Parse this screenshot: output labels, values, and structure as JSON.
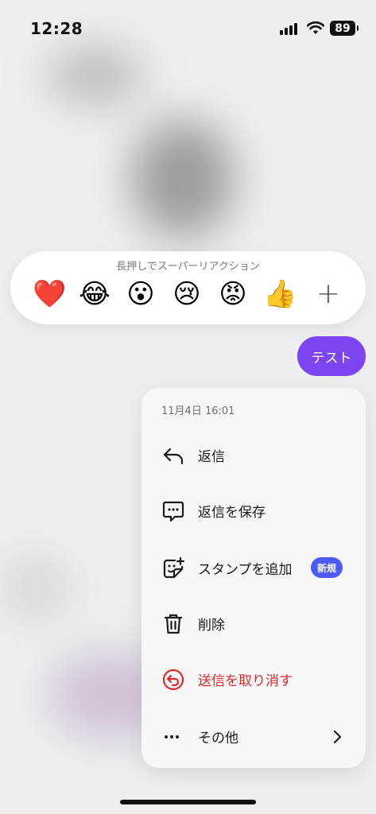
{
  "status_bar": {
    "time": "12:28",
    "battery": "89"
  },
  "reactions": {
    "hint": "長押しでスーパーリアクション",
    "items": [
      {
        "emoji": "❤️",
        "icon": "heart-icon"
      },
      {
        "emoji": "😂",
        "icon": "laughing-icon"
      },
      {
        "emoji": "😮",
        "icon": "surprised-icon"
      },
      {
        "emoji": "😢",
        "icon": "crying-icon"
      },
      {
        "emoji": "😡",
        "icon": "angry-icon"
      },
      {
        "emoji": "👍",
        "icon": "thumbs-up-icon"
      }
    ],
    "plus": "+"
  },
  "message": {
    "text": "テスト",
    "bubble_color": "#7d45f2"
  },
  "menu": {
    "date": "11月4日 16:01",
    "items": [
      {
        "label": "返信",
        "icon": "reply-icon"
      },
      {
        "label": "返信を保存",
        "icon": "save-reply-icon"
      },
      {
        "label": "スタンプを追加",
        "icon": "add-sticker-icon",
        "badge": "新規"
      },
      {
        "label": "削除",
        "icon": "trash-icon"
      },
      {
        "label": "送信を取り消す",
        "icon": "unsend-icon",
        "color": "#e02a2a"
      },
      {
        "label": "その他",
        "icon": "more-icon"
      }
    ]
  }
}
